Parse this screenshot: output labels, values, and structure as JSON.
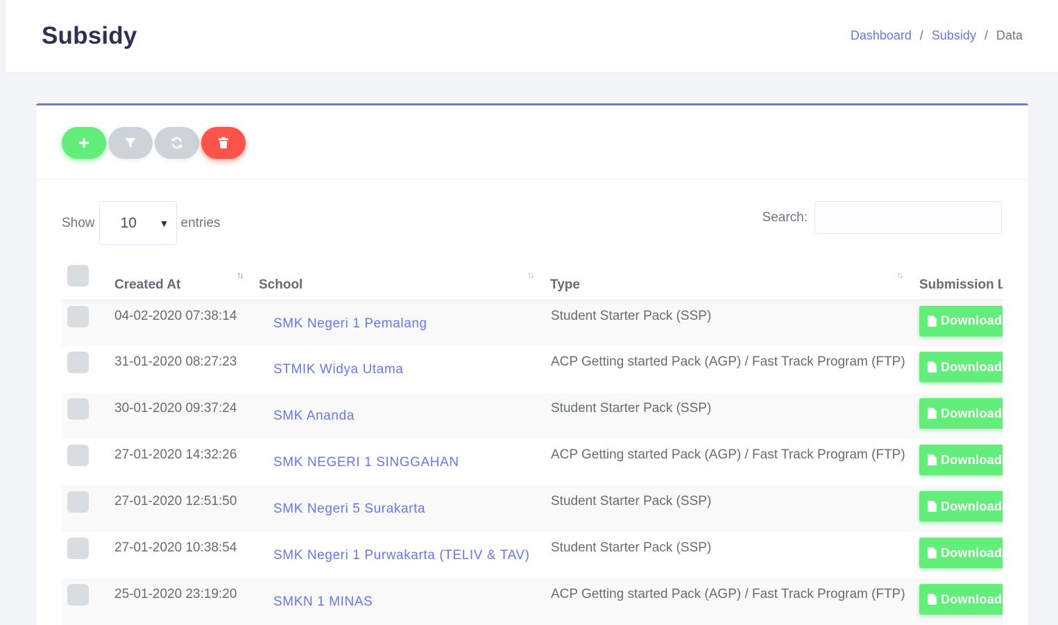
{
  "header": {
    "title": "Subsidy",
    "breadcrumb": [
      {
        "label": "Dashboard"
      },
      {
        "label": "Subsidy"
      },
      {
        "label": "Data"
      }
    ]
  },
  "toolbar": {
    "buttons": [
      {
        "name": "add",
        "icon": "plus-icon",
        "color": "#63ed7a"
      },
      {
        "name": "filter",
        "icon": "filter-icon",
        "color": "#cdd3d8"
      },
      {
        "name": "refresh",
        "icon": "refresh-icon",
        "color": "#cdd3d8"
      },
      {
        "name": "delete",
        "icon": "trash-icon",
        "color": "#fc544b"
      }
    ]
  },
  "length": {
    "show_label": "Show",
    "value": "10",
    "entries_label": "entries"
  },
  "search": {
    "label": "Search:",
    "value": "",
    "placeholder": ""
  },
  "table": {
    "columns": [
      "Created At",
      "School",
      "Type",
      "Submission L"
    ],
    "download_label": "Download",
    "rows": [
      {
        "created_at": "04-02-2020 07:38:14",
        "school": "SMK Negeri 1 Pemalang",
        "type": "Student Starter Pack (SSP)"
      },
      {
        "created_at": "31-01-2020 08:27:23",
        "school": "STMIK Widya Utama",
        "type": "ACP Getting started Pack (AGP) / Fast Track Program (FTP)"
      },
      {
        "created_at": "30-01-2020 09:37:24",
        "school": "SMK Ananda",
        "type": "Student Starter Pack (SSP)"
      },
      {
        "created_at": "27-01-2020 14:32:26",
        "school": "SMK NEGERI 1 SINGGAHAN",
        "type": "ACP Getting started Pack (AGP) / Fast Track Program (FTP)"
      },
      {
        "created_at": "27-01-2020 12:51:50",
        "school": "SMK Negeri 5 Surakarta",
        "type": "Student Starter Pack (SSP)"
      },
      {
        "created_at": "27-01-2020 10:38:54",
        "school": "SMK Negeri 1 Purwakarta (TELIV & TAV)",
        "type": "Student Starter Pack (SSP)"
      },
      {
        "created_at": "25-01-2020 23:19:20",
        "school": "SMKN 1 MINAS",
        "type": "ACP Getting started Pack (AGP) / Fast Track Program (FTP)"
      }
    ]
  },
  "colors": {
    "primary": "#6777ef",
    "success": "#63ed7a",
    "danger": "#fc544b",
    "light": "#cdd3d8"
  }
}
